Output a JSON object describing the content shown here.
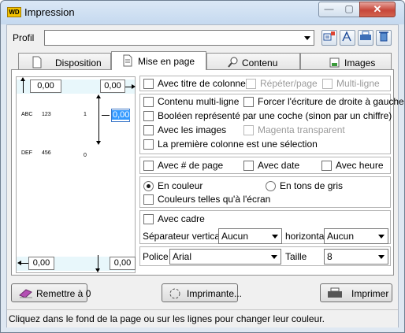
{
  "window": {
    "title": "Impression",
    "app_icon_text": "WD",
    "minimize_glyph": "—",
    "maximize_glyph": "▢",
    "close_glyph": "✕"
  },
  "profil": {
    "label": "Profil",
    "value": ""
  },
  "toolbar_icons": [
    "save-profile-icon",
    "font-style-icon",
    "printer-icon",
    "delete-icon"
  ],
  "tabs": [
    {
      "label": "Disposition",
      "icon": "page-icon",
      "active": false
    },
    {
      "label": "Mise en page",
      "icon": "layout-icon",
      "active": true
    },
    {
      "label": "Contenu",
      "icon": "magnifier-icon",
      "active": false
    },
    {
      "label": "Images",
      "icon": "image-icon",
      "active": false
    }
  ],
  "preview": {
    "margin_top_left": "0,00",
    "margin_top_right": "0,00",
    "margin_right_column": "0,00",
    "margin_bottom_left": "0,00",
    "margin_bottom_right": "0,00",
    "row1": [
      "ABC",
      "123",
      "1"
    ],
    "row2": [
      "DEF",
      "456",
      "0"
    ]
  },
  "options": {
    "titre_colonne": "Avec titre de colonne",
    "repeter_page": "Répéter/page",
    "multi_ligne": "Multi-ligne",
    "contenu_multi_ligne": "Contenu multi-ligne",
    "forcer_ecriture": "Forcer l'écriture de droite à gauche",
    "booleen_coche": "Booléen représenté par une coche (sinon par un chiffre)",
    "avec_images": "Avec les images",
    "magenta": "Magenta transparent",
    "premiere_colonne": "La première colonne est une sélection",
    "num_page": "Avec # de page",
    "date": "Avec date",
    "heure": "Avec heure",
    "en_couleur": "En couleur",
    "tons_de_gris": "En tons de gris",
    "couleurs_ecran": "Couleurs telles qu'à l'écran",
    "avec_cadre": "Avec cadre",
    "sep_vertical_label": "Séparateur vertical",
    "sep_vertical_value": "Aucun",
    "horizontal_label": "horizontal",
    "horizontal_value": "Aucun",
    "police_label": "Police",
    "police_value": "Arial",
    "taille_label": "Taille",
    "taille_value": "8"
  },
  "buttons": {
    "reset": "Remettre à 0",
    "printer": "Imprimante...",
    "print": "Imprimer"
  },
  "status": "Cliquez dans le fond de la page ou sur les lignes pour changer leur couleur."
}
